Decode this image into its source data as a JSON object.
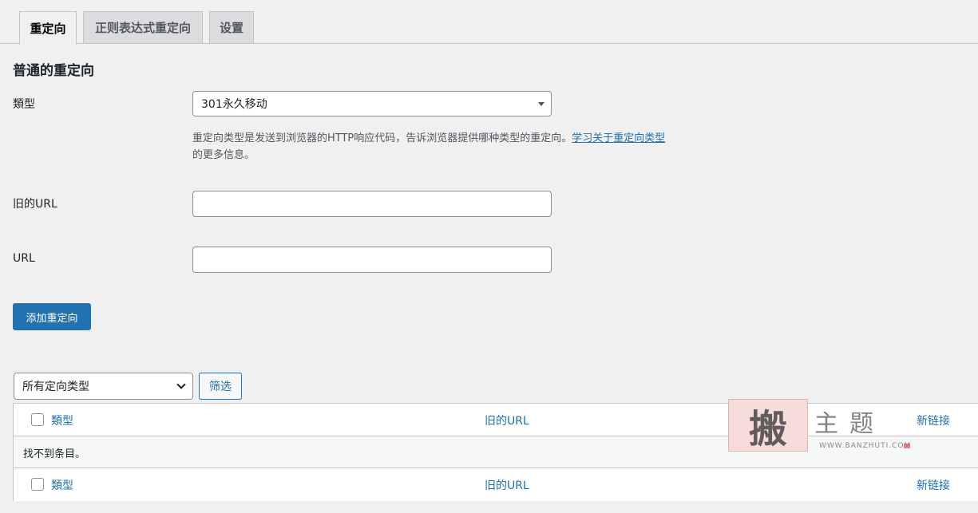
{
  "tabs": [
    {
      "label": "重定向",
      "active": true
    },
    {
      "label": "正则表达式重定向",
      "active": false
    },
    {
      "label": "设置",
      "active": false
    }
  ],
  "section": {
    "title": "普通的重定向"
  },
  "form": {
    "type_label": "類型",
    "type_value": "301永久移动",
    "description_text": "重定向类型是发送到浏览器的HTTP响应代码，告诉浏览器提供哪种类型的重定向。",
    "description_link": "学习关于重定向类型",
    "description_suffix": "的更多信息。",
    "old_url_label": "旧的URL",
    "old_url_value": "",
    "url_label": "URL",
    "url_value": "",
    "add_button": "添加重定向"
  },
  "filter": {
    "select_value": "所有定向类型",
    "button_label": "筛选"
  },
  "table": {
    "columns": [
      "類型",
      "旧的URL",
      "新链接"
    ],
    "empty_message": "找不到条目。",
    "footer_columns": [
      "類型",
      "旧的URL",
      "新链接"
    ]
  },
  "watermark": {
    "mark_char": "搬",
    "text": "主题",
    "url": "WWW.BANZHUTI.COM"
  },
  "colors": {
    "accent": "#2271b1",
    "background": "#f0f0f1"
  }
}
